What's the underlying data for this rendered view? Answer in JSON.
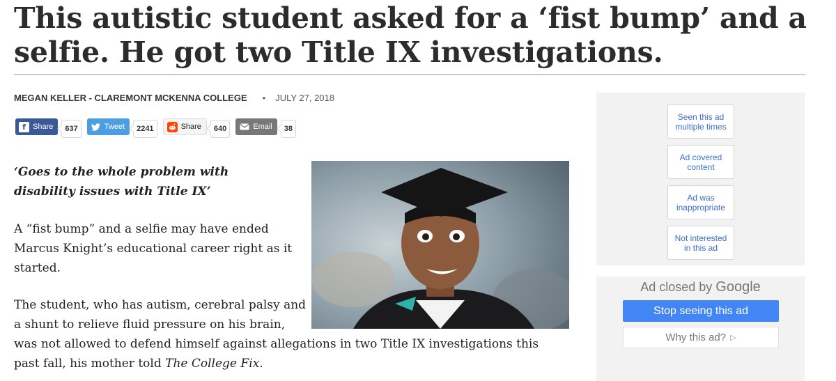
{
  "article": {
    "headline": "This autistic student asked for a ‘fist bump’ and a selfie. He got two Title IX investigations.",
    "author": "MEGAN KELLER - CLAREMONT MCKENNA COLLEGE",
    "separator": "•",
    "date": "JULY 27, 2018",
    "dek": "‘Goes to the whole problem with disability issues with Title IX’",
    "paragraph1": "A “fist bump” and a selfie may have ended Marcus Knight’s educational career right as it started.",
    "paragraph2_line1": "The student, who has autism, cerebral palsy and a shunt to relieve fluid pressure on his brain,",
    "paragraph2_rest": "was not allowed to defend himself against allegations in two Title IX investigations this past fall, his mother told ",
    "paragraph2_source": "The College Fix",
    "paragraph2_end": "."
  },
  "share": {
    "facebook": {
      "label": "Share",
      "count": "637",
      "icon": "facebook-icon",
      "color": "#3b5998"
    },
    "twitter": {
      "label": "Tweet",
      "count": "2241",
      "icon": "twitter-bird-icon",
      "color": "#4b9fe0"
    },
    "reddit": {
      "label": "Share",
      "count": "640",
      "icon": "reddit-icon",
      "color": "#ff4500"
    },
    "email": {
      "label": "Email",
      "count": "38",
      "icon": "envelope-icon",
      "color": "#777777"
    }
  },
  "ad_feedback": {
    "options": [
      "Seen this ad multiple times",
      "Ad covered content",
      "Ad was inappropriate",
      "Not interested in this ad"
    ]
  },
  "ad_closed": {
    "label": "Ad closed by",
    "brand": "Google",
    "stop_button": "Stop seeing this ad",
    "why_button": "Why this ad?",
    "why_icon": "play-triangle-icon",
    "accent": "#4285f4"
  }
}
